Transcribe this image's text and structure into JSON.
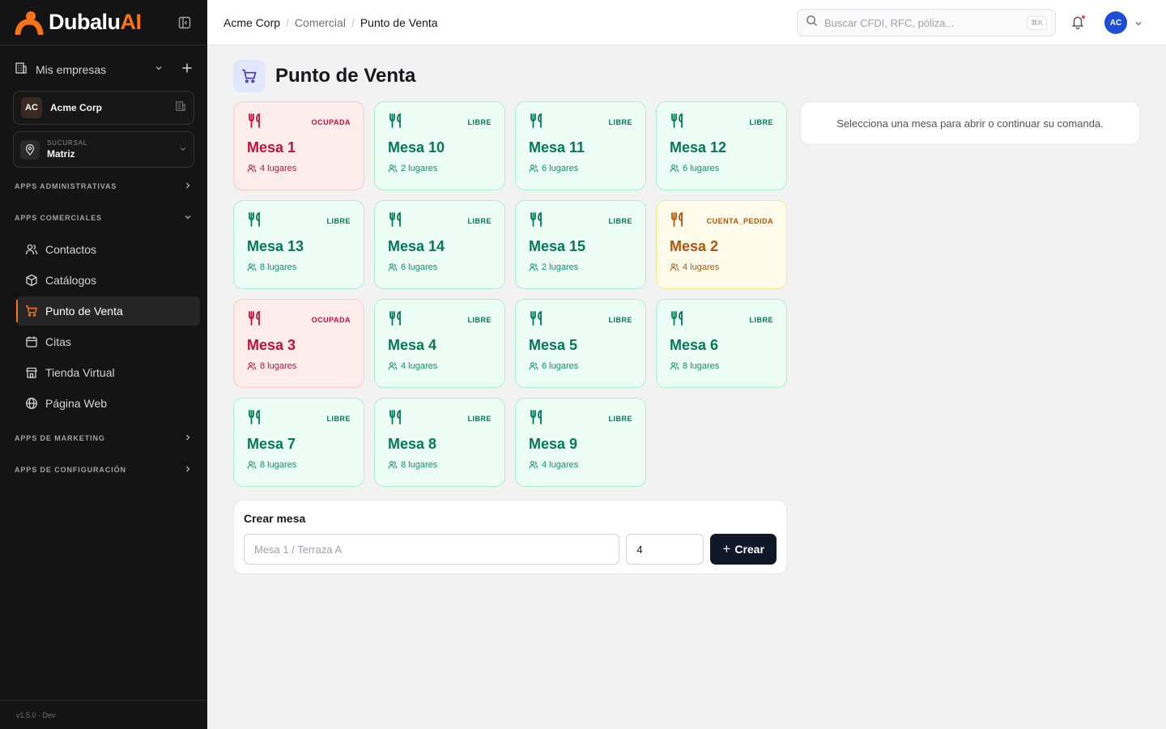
{
  "brand": {
    "name": "Dubalu",
    "suffix": "AI"
  },
  "sidebar": {
    "mis_empresas": "Mis empresas",
    "company": {
      "badge": "AC",
      "name": "Acme Corp"
    },
    "branch": {
      "label": "SUCURSAL",
      "value": "Matriz"
    },
    "groups": {
      "admin": "APPS ADMINISTRATIVAS",
      "comerciales": "APPS COMERCIALES",
      "marketing": "APPS DE MARKETING",
      "config": "APPS DE CONFIGURACIÓN"
    },
    "items": [
      {
        "label": "Contactos",
        "icon": "users-icon"
      },
      {
        "label": "Catálogos",
        "icon": "box-icon"
      },
      {
        "label": "Punto de Venta",
        "icon": "cart-icon",
        "active": true
      },
      {
        "label": "Citas",
        "icon": "calendar-icon"
      },
      {
        "label": "Tienda Virtual",
        "icon": "store-icon"
      },
      {
        "label": "Página Web",
        "icon": "globe-icon"
      }
    ],
    "version": "v1.5.0 · Dev"
  },
  "topbar": {
    "breadcrumb": [
      "Acme Corp",
      "Comercial",
      "Punto de Venta"
    ],
    "search_placeholder": "Buscar CFDI, RFC, póliza...",
    "shortcut": "⌘K",
    "avatar": "AC"
  },
  "page": {
    "title": "Punto de Venta"
  },
  "tables": [
    {
      "name": "Mesa 1",
      "status": "OCUPADA",
      "seats": "4 lugares",
      "kind": "ocupada"
    },
    {
      "name": "Mesa 10",
      "status": "LIBRE",
      "seats": "2 lugares",
      "kind": "libre"
    },
    {
      "name": "Mesa 11",
      "status": "LIBRE",
      "seats": "6 lugares",
      "kind": "libre"
    },
    {
      "name": "Mesa 12",
      "status": "LIBRE",
      "seats": "6 lugares",
      "kind": "libre"
    },
    {
      "name": "Mesa 13",
      "status": "LIBRE",
      "seats": "8 lugares",
      "kind": "libre"
    },
    {
      "name": "Mesa 14",
      "status": "LIBRE",
      "seats": "6 lugares",
      "kind": "libre"
    },
    {
      "name": "Mesa 15",
      "status": "LIBRE",
      "seats": "2 lugares",
      "kind": "libre"
    },
    {
      "name": "Mesa 2",
      "status": "CUENTA_PEDIDA",
      "seats": "4 lugares",
      "kind": "cuenta"
    },
    {
      "name": "Mesa 3",
      "status": "OCUPADA",
      "seats": "8 lugares",
      "kind": "ocupada"
    },
    {
      "name": "Mesa 4",
      "status": "LIBRE",
      "seats": "4 lugares",
      "kind": "libre"
    },
    {
      "name": "Mesa 5",
      "status": "LIBRE",
      "seats": "6 lugares",
      "kind": "libre"
    },
    {
      "name": "Mesa 6",
      "status": "LIBRE",
      "seats": "8 lugares",
      "kind": "libre"
    },
    {
      "name": "Mesa 7",
      "status": "LIBRE",
      "seats": "8 lugares",
      "kind": "libre"
    },
    {
      "name": "Mesa 8",
      "status": "LIBRE",
      "seats": "8 lugares",
      "kind": "libre"
    },
    {
      "name": "Mesa 9",
      "status": "LIBRE",
      "seats": "4 lugares",
      "kind": "libre"
    }
  ],
  "side_panel": {
    "message": "Selecciona una mesa para abrir o continuar su comanda."
  },
  "create": {
    "title": "Crear mesa",
    "name_placeholder": "Mesa 1 / Terraza A",
    "seats_value": "4",
    "button": "Crear"
  },
  "colors": {
    "accent": "#f97316",
    "libre": "#047857",
    "ocupada": "#be123c",
    "cuenta": "#b45309",
    "sidebar_bg": "#141414"
  }
}
